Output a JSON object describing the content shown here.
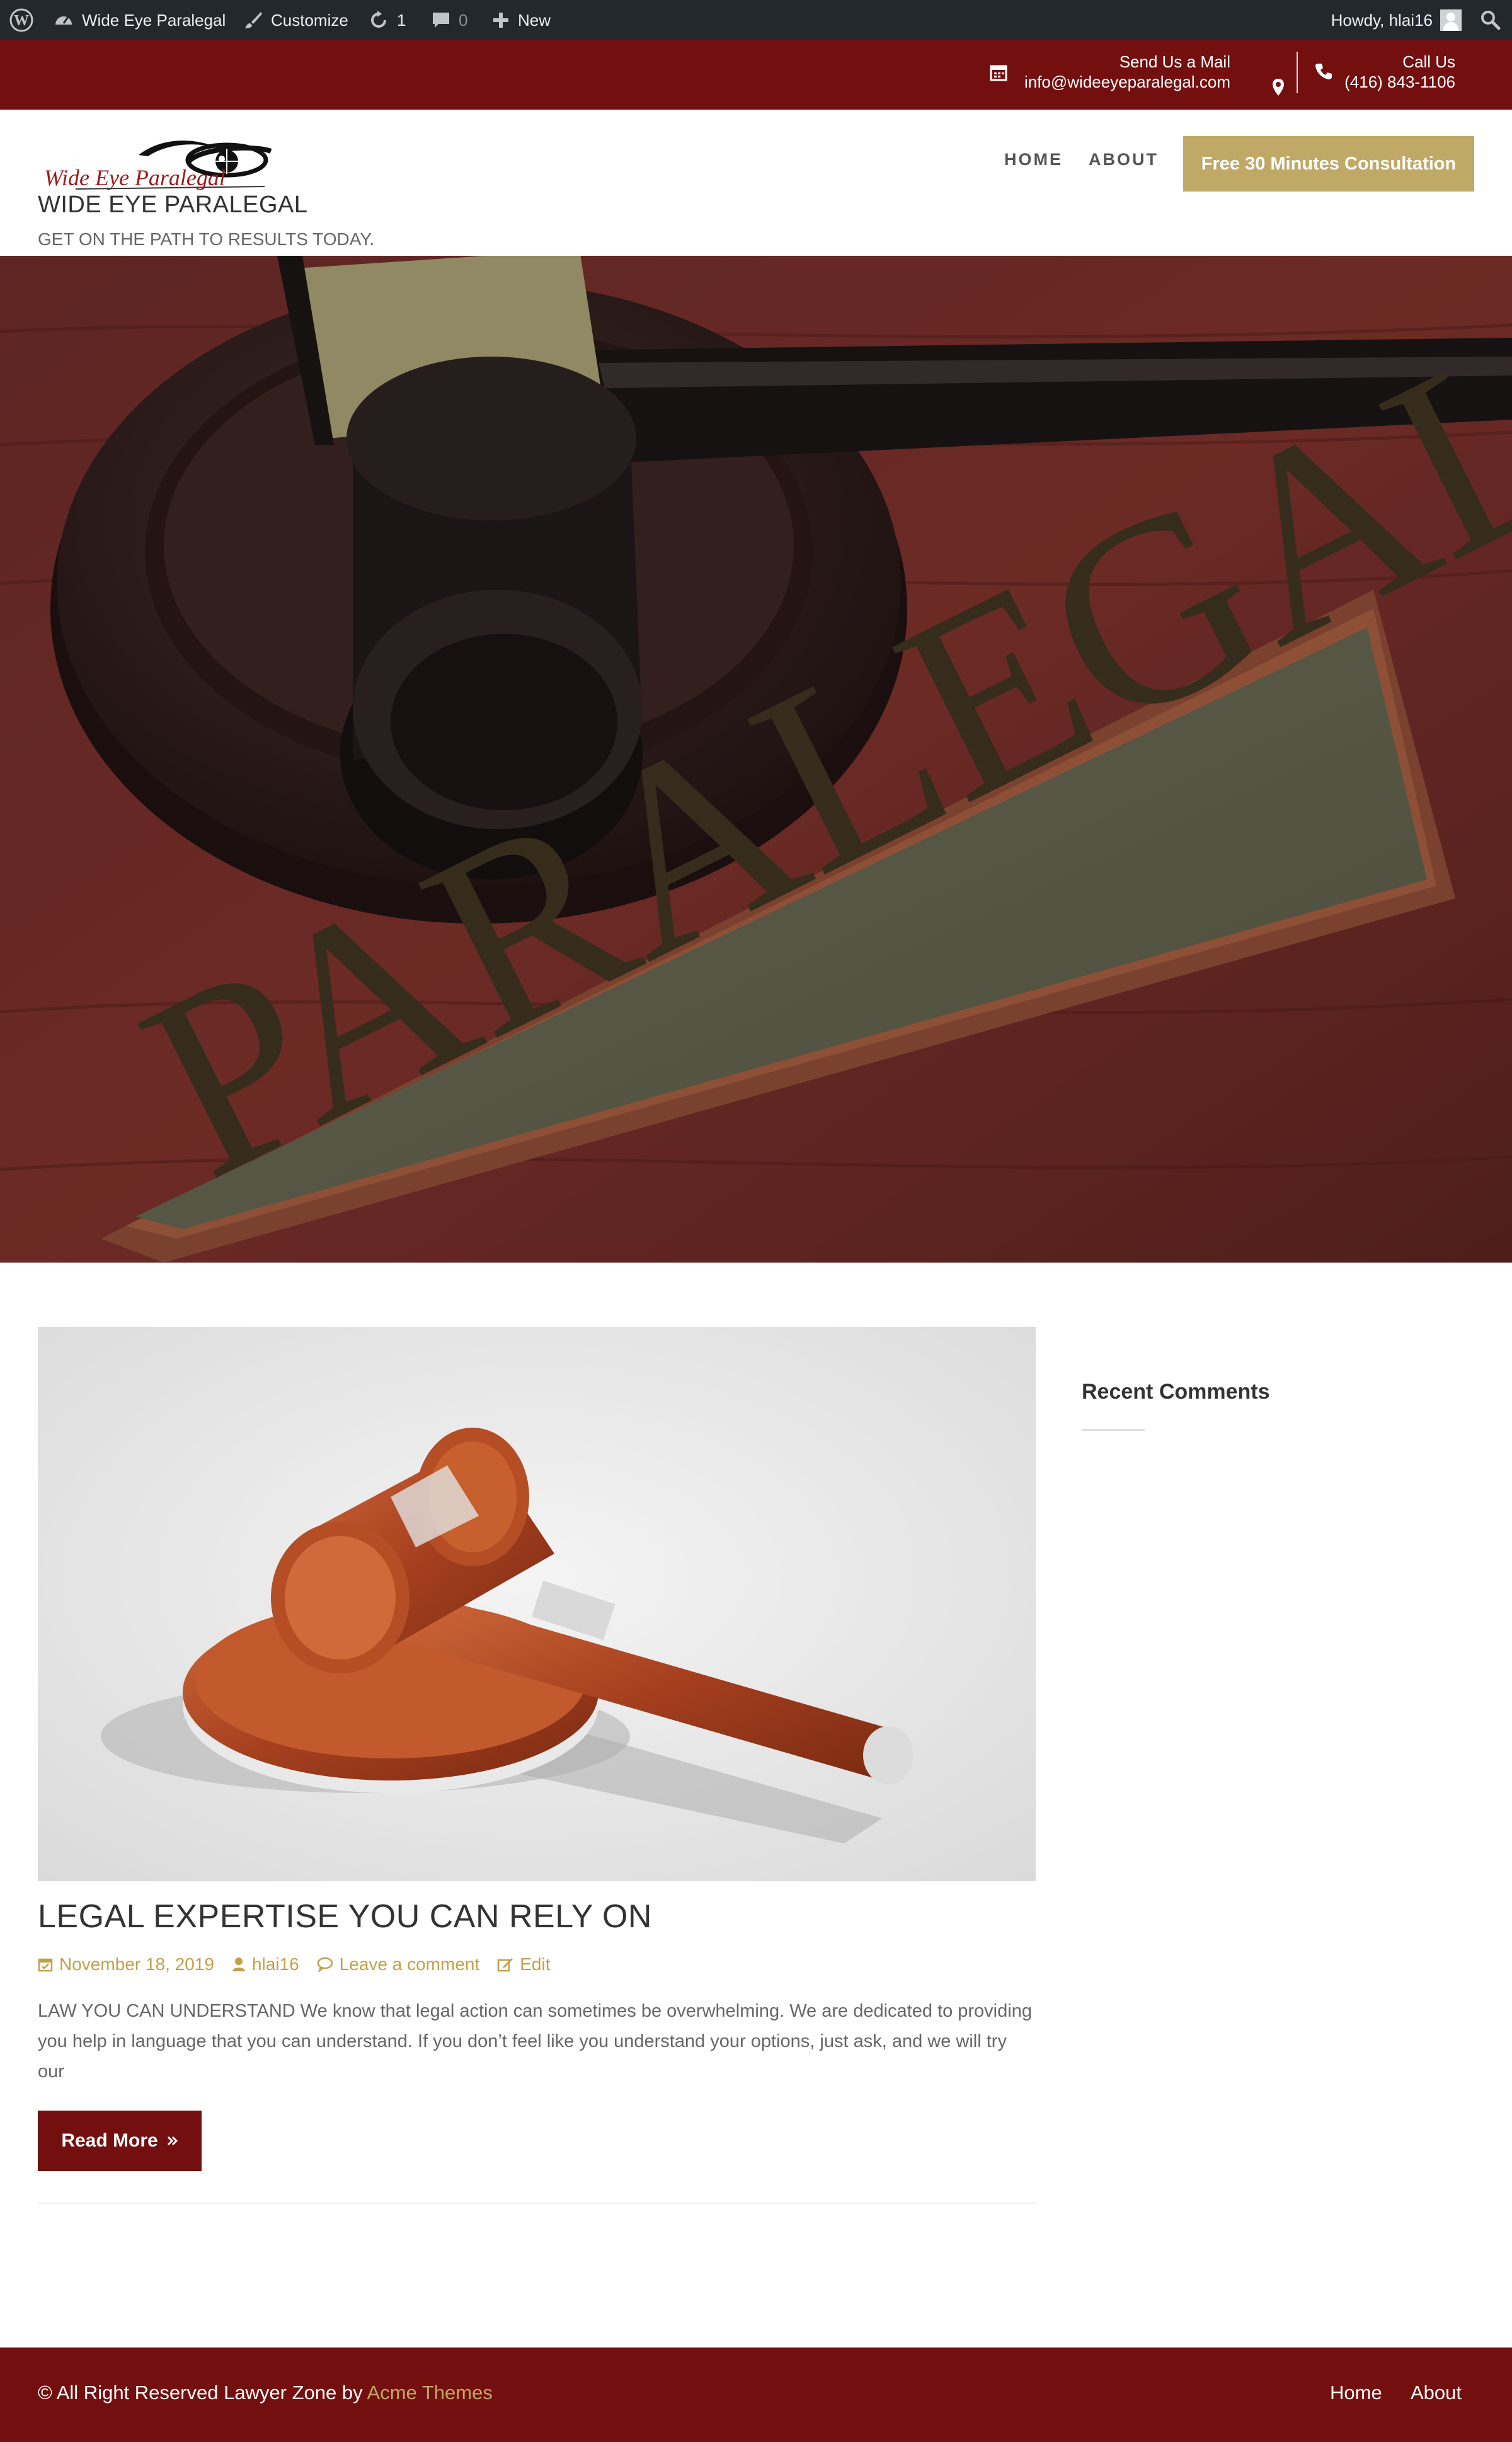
{
  "admin_bar": {
    "site_name": "Wide Eye Paralegal",
    "customize": "Customize",
    "updates_count": "1",
    "comments_count": "0",
    "new_label": "New",
    "greeting": "Howdy, hlai16"
  },
  "topbar": {
    "mail_label": "Send Us a Mail",
    "mail_value": "info@wideeyeparalegal.com",
    "phone_label": "Call Us",
    "phone_value": "(416) 843-1106"
  },
  "header": {
    "logo_text": "Wide Eye Paralegal",
    "site_title": "WIDE EYE PARALEGAL",
    "tagline": "GET ON THE PATH TO RESULTS TODAY.",
    "nav": [
      "HOME",
      "ABOUT"
    ],
    "cta_label": "Free 30 Minutes Consultation"
  },
  "hero": {
    "nameplate_text": "PARALEGAL"
  },
  "post": {
    "title": "LEGAL EXPERTISE YOU CAN RELY ON",
    "date": "November 18, 2019",
    "author": "hlai16",
    "comments_link": "Leave a comment",
    "edit_link": "Edit",
    "excerpt": "LAW YOU CAN UNDERSTAND We know that legal action can sometimes be overwhelming. We are dedicated to providing you help in language that you can understand. If you don’t feel like you understand your options, just ask, and we will try our",
    "read_more": "Read More"
  },
  "sidebar": {
    "widget_title": "Recent Comments"
  },
  "footer": {
    "copyright_prefix": "© All Right Reserved Lawyer Zone by ",
    "copyright_link": "Acme Themes",
    "links": [
      "Home",
      "About"
    ]
  },
  "colors": {
    "brand_maroon": "#73100f",
    "accent_gold": "#c0a866",
    "admin_bar": "#23282d"
  }
}
